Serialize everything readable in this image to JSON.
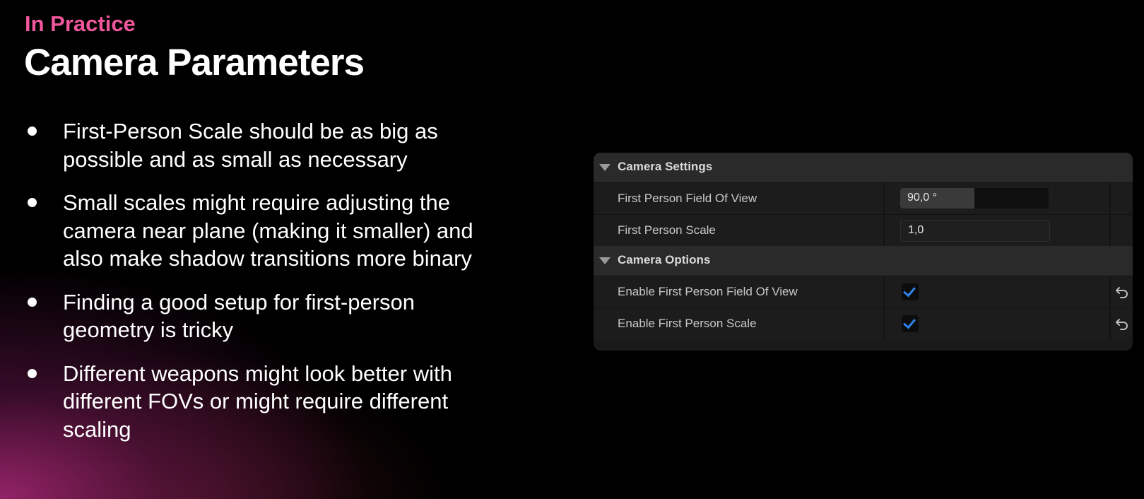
{
  "slide": {
    "eyebrow": "In Practice",
    "title": "Camera Parameters",
    "bullets": [
      "First-Person Scale should be as big as possible and as small as necessary",
      "Small scales might require adjusting the camera near plane (making it smaller) and also make shadow transitions more binary",
      "Finding a good setup for first-person geometry is tricky",
      "Different weapons might look better with different FOVs or might require different scaling"
    ],
    "accent_color": "#f0579c"
  },
  "panel": {
    "camera_settings": {
      "header": "Camera Settings",
      "fov_label": "First Person Field Of View",
      "fov_value": "90,0 °",
      "fov_fill_fraction": 0.5,
      "scale_label": "First Person Scale",
      "scale_value": "1,0"
    },
    "camera_options": {
      "header": "Camera Options",
      "enable_fov_label": "Enable First Person Field Of View",
      "enable_fov_checked": true,
      "enable_scale_label": "Enable First Person Scale",
      "enable_scale_checked": true
    },
    "checkbox_color": "#2f83e8",
    "icons": {
      "collapse": "triangle-down-icon",
      "reset": "reset-arrow-icon"
    }
  }
}
